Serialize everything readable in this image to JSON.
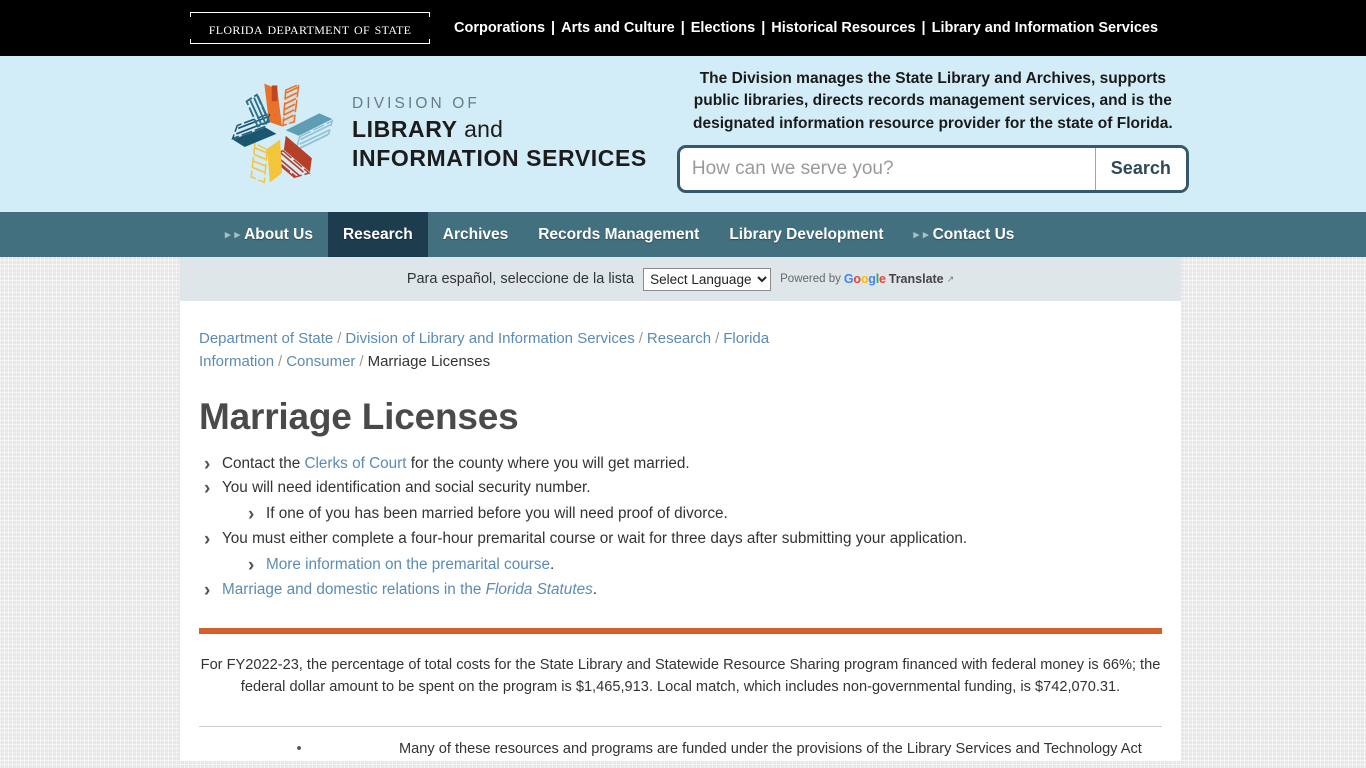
{
  "topbar": {
    "logo_text_parts": [
      "Florida",
      "Department",
      "of",
      "State"
    ],
    "logo_full": "Florida Department of State",
    "links": [
      "Corporations",
      "Arts and Culture",
      "Elections",
      "Historical Resources",
      "Library and Information Services"
    ],
    "separator": "|"
  },
  "header": {
    "brand": {
      "line1": "DIVISION OF",
      "line2_bold": "LIBRARY",
      "line2_light": "and",
      "line3": "INFORMATION SERVICES",
      "logo_icon": "pinwheel-books-logo"
    },
    "tagline": "The Division manages the State Library and Archives, supports public libraries, directs records management services, and is the designated information resource provider for the state of Florida.",
    "search": {
      "placeholder": "How can we serve you?",
      "value": "",
      "button_label": "Search"
    }
  },
  "mainnav": {
    "items": [
      {
        "label": "About Us",
        "has_chevrons": true,
        "active": false
      },
      {
        "label": "Research",
        "has_chevrons": false,
        "active": true
      },
      {
        "label": "Archives",
        "has_chevrons": false,
        "active": false
      },
      {
        "label": "Records Management",
        "has_chevrons": false,
        "active": false
      },
      {
        "label": "Library Development",
        "has_chevrons": false,
        "active": false
      },
      {
        "label": "Contact Us",
        "has_chevrons": true,
        "active": false
      }
    ]
  },
  "translate_bar": {
    "label": "Para español, seleccione de la lista",
    "select_value": "Select Language",
    "select_options": [
      "Select Language"
    ],
    "powered_by": "Powered by",
    "google_letters": [
      "G",
      "o",
      "o",
      "g",
      "l",
      "e"
    ],
    "translate_word": "Translate",
    "external_icon": "external-link-icon"
  },
  "breadcrumb": {
    "items": [
      {
        "label": "Department of State",
        "current": false
      },
      {
        "label": "Division of Library and Information Services",
        "current": false
      },
      {
        "label": "Research",
        "current": false
      },
      {
        "label": "Florida Information",
        "current": false
      },
      {
        "label": "Consumer",
        "current": false
      },
      {
        "label": "Marriage Licenses",
        "current": true
      }
    ],
    "separator": "/"
  },
  "main": {
    "title": "Marriage Licenses",
    "bullets": {
      "b1_pre": "Contact the ",
      "b1_link": "Clerks of Court",
      "b1_post": " for the county where you will get married.",
      "b2": "You will need identification and social security number.",
      "b2_sub": "If one of you has been married before you will need proof of divorce.",
      "b3": "You must either complete a four-hour premarital course or wait for three days after submitting your application.",
      "b3_sub_link": "More information on the premarital course",
      "b3_sub_post": ".",
      "b4_link_pre": "Marriage and domestic relations in the ",
      "b4_link_italic": "Florida Statutes",
      "b4_post": "."
    }
  },
  "footer": {
    "funding_note": "For FY2022-23, the percentage of total costs for the State Library and Statewide Resource Sharing program financed with federal money is 66%; the federal dollar amount to be spent on the program is $1,465,913. Local match, which includes non-governmental funding, is $742,070.31.",
    "lsta_bullet": "•",
    "lsta_note": "Many of these resources and programs are funded under the provisions of the Library Services and Technology Act"
  },
  "colors": {
    "topbar_bg": "#000000",
    "header_bg": "#d3edf8",
    "nav_bg": "#43707f",
    "nav_active_bg": "#1d3c4e",
    "translate_bar_bg": "#dfe6ea",
    "link_blue": "#5b8bb5",
    "orange_rule": "#d4602c",
    "page_bg": "#e9e6e6"
  }
}
